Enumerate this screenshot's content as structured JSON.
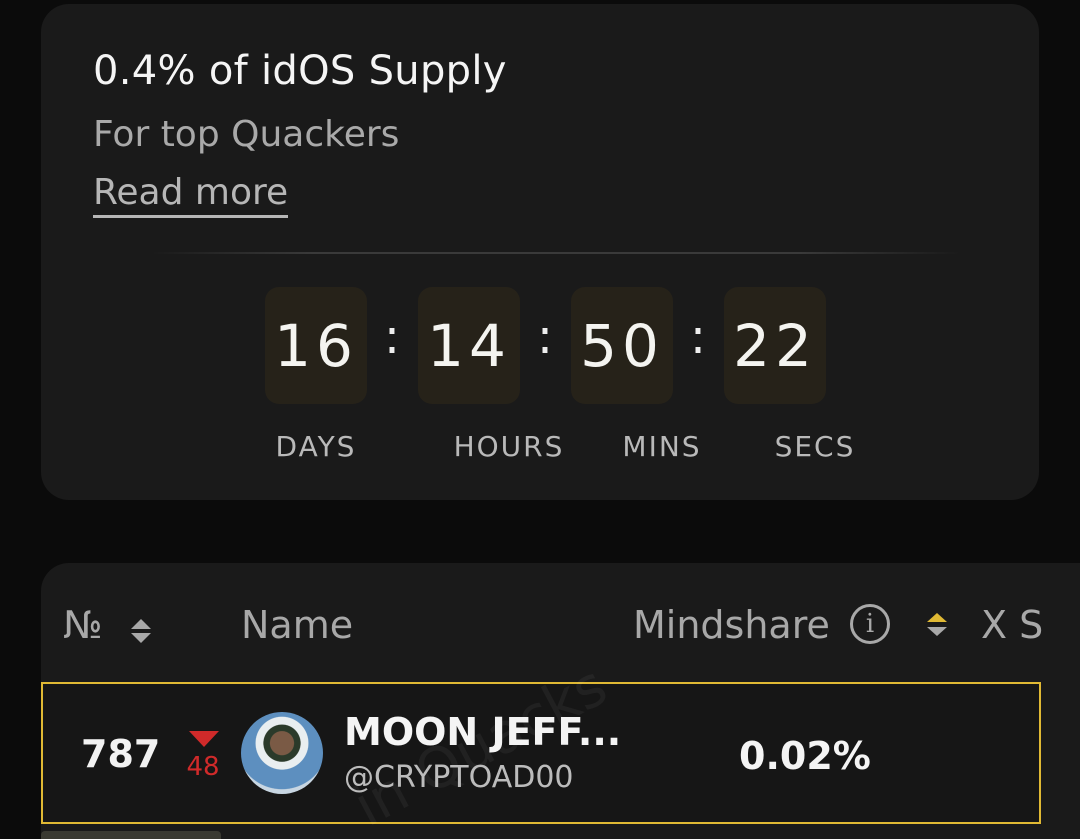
{
  "reward_card": {
    "title": "0.4% of idOS Supply",
    "subtitle": "For top Quackers",
    "read_more": "Read more",
    "countdown": {
      "days": "16",
      "hours": "14",
      "mins": "50",
      "secs": "22",
      "separator": ":",
      "labels": {
        "days": "DAYS",
        "hours": "HOURS",
        "mins": "MINS",
        "secs": "SECS"
      }
    }
  },
  "leaderboard": {
    "columns": {
      "rank": "№",
      "name": "Name",
      "mindshare": "Mindshare",
      "x": "X S"
    },
    "info_glyph": "i",
    "highlighted_row": {
      "rank": "787",
      "delta": "48",
      "delta_direction": "down",
      "name": "MOON JEFF...",
      "handle": "@CRYPTOAD00",
      "mindshare": "0.02%"
    },
    "watermark": "in Quacks"
  },
  "colors": {
    "accent_gold": "#e0b934",
    "delta_red": "#d02a2a",
    "card_bg": "#1a1a1a",
    "tile_bg": "#262219"
  }
}
